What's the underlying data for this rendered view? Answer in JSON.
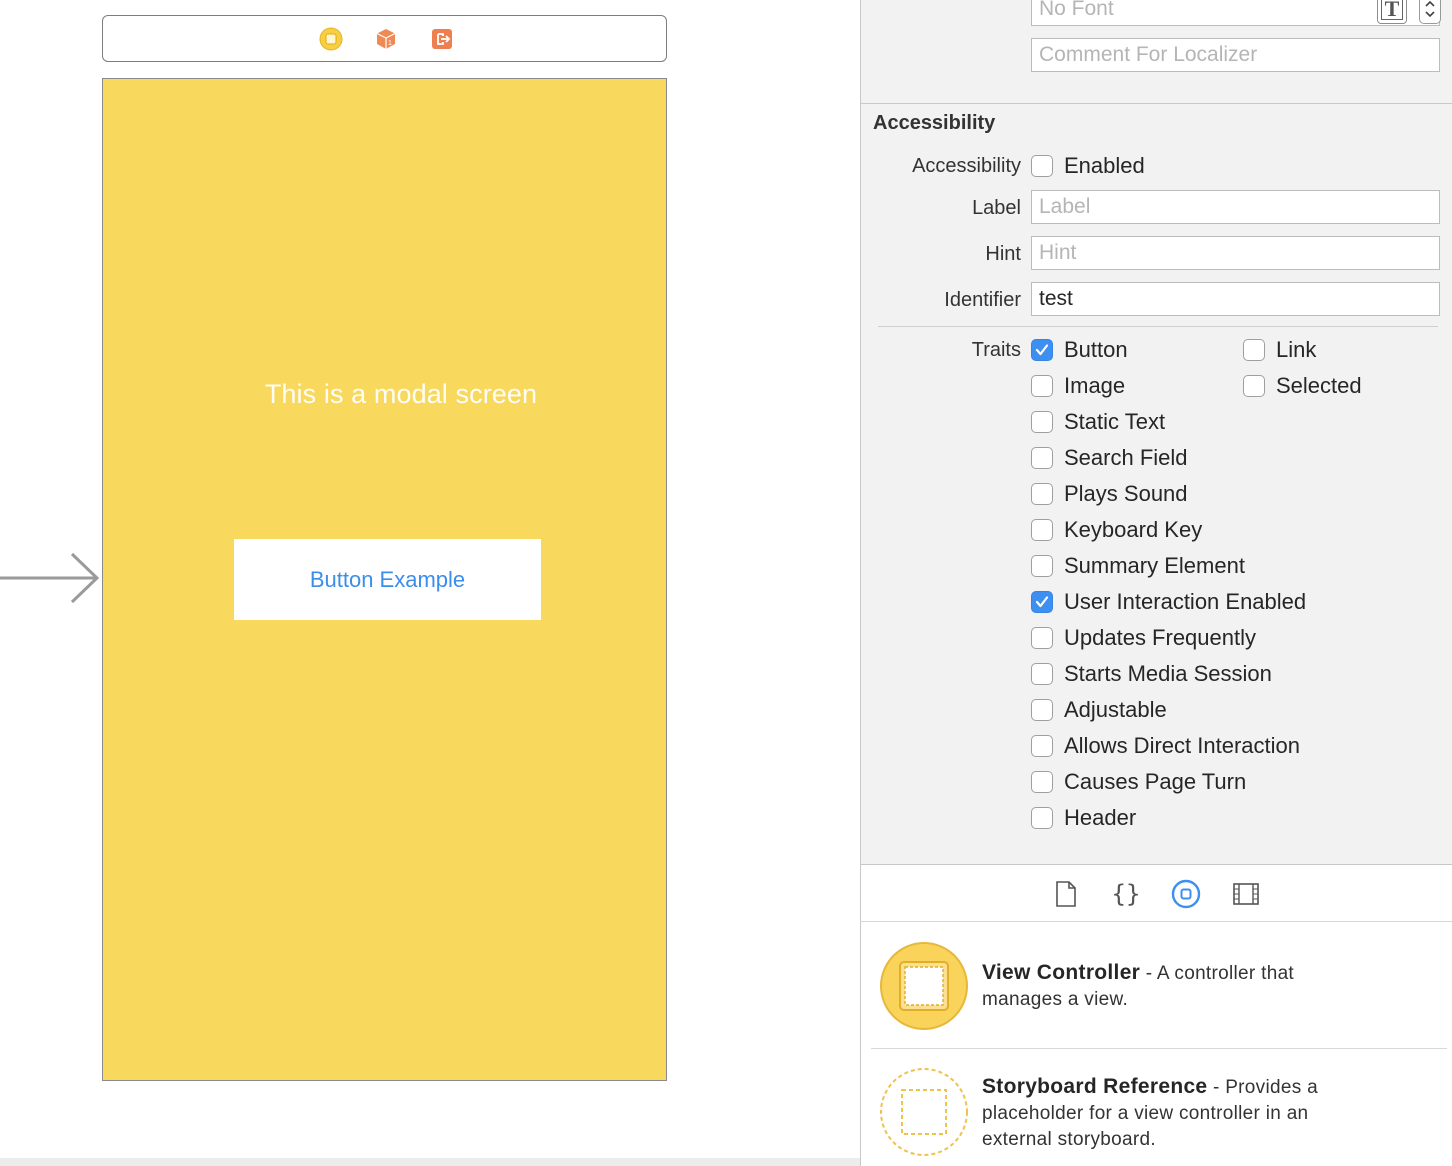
{
  "canvas": {
    "modal_label": "This is a modal screen",
    "button_label": "Button Example",
    "background_color": "#f9d85e",
    "dock_icons": [
      "view-controller-icon",
      "first-responder-icon",
      "exit-icon"
    ]
  },
  "inspector": {
    "font_field": {
      "value": "No Font"
    },
    "comment_field": {
      "placeholder": "Comment For Localizer"
    },
    "section_title": "Accessibility",
    "accessibility": {
      "label": "Accessibility",
      "enabled_label": "Enabled",
      "enabled": false
    },
    "label_field": {
      "label": "Label",
      "placeholder": "Label",
      "value": ""
    },
    "hint_field": {
      "label": "Hint",
      "placeholder": "Hint",
      "value": ""
    },
    "identifier_field": {
      "label": "Identifier",
      "value": "test"
    },
    "traits": {
      "label": "Traits",
      "left": [
        {
          "label": "Button",
          "checked": true
        },
        {
          "label": "Image",
          "checked": false
        },
        {
          "label": "Static Text",
          "checked": false
        },
        {
          "label": "Search Field",
          "checked": false
        },
        {
          "label": "Plays Sound",
          "checked": false
        },
        {
          "label": "Keyboard Key",
          "checked": false
        },
        {
          "label": "Summary Element",
          "checked": false
        },
        {
          "label": "User Interaction Enabled",
          "checked": true
        },
        {
          "label": "Updates Frequently",
          "checked": false
        },
        {
          "label": "Starts Media Session",
          "checked": false
        },
        {
          "label": "Adjustable",
          "checked": false
        },
        {
          "label": "Allows Direct Interaction",
          "checked": false
        },
        {
          "label": "Causes Page Turn",
          "checked": false
        },
        {
          "label": "Header",
          "checked": false
        }
      ],
      "right": [
        {
          "label": "Link",
          "checked": false
        },
        {
          "label": "Selected",
          "checked": false
        }
      ]
    }
  },
  "library": {
    "tabs": [
      "file-template-icon",
      "code-snippet-icon",
      "object-library-icon",
      "media-library-icon"
    ],
    "active_tab": "object-library-icon",
    "items": [
      {
        "title": "View Controller",
        "description": " - A controller that manages a view."
      },
      {
        "title": "Storyboard Reference",
        "description": " - Provides a placeholder for a view controller in an external storyboard."
      }
    ]
  }
}
